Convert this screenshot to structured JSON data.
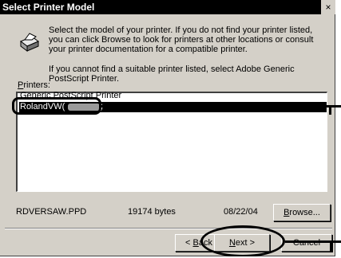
{
  "dialog": {
    "title": "Select Printer Model",
    "close_glyph": "×",
    "intro": "Select the model of your printer. If you do not find your printer listed, you can click Browse to look for printers at other locations or consult your printer documentation for a compatible printer.",
    "intro2": "If you cannot find a suitable printer listed, select Adobe Generic PostScript Printer."
  },
  "printers": {
    "label_prefix": "",
    "label_mnemonic": "P",
    "label_rest": "rinters:",
    "items": [
      {
        "label": "Generic PostScript Printer",
        "state": "partial"
      },
      {
        "label": "RolandVW(",
        "suffix": ")",
        "state": "selected"
      }
    ]
  },
  "file_info": {
    "filename": "RDVERSAW.PPD",
    "size": "19174 bytes",
    "date": "08/22/04"
  },
  "buttons": {
    "browse_mnemonic": "B",
    "browse_rest": "rowse...",
    "back_prefix": "< ",
    "back_mnemonic": "B",
    "back_rest": "ack",
    "next_mnemonic": "N",
    "next_rest": "ext >",
    "cancel": "Cancel"
  },
  "icons": {
    "printer": "printer-icon",
    "close": "close-icon"
  }
}
